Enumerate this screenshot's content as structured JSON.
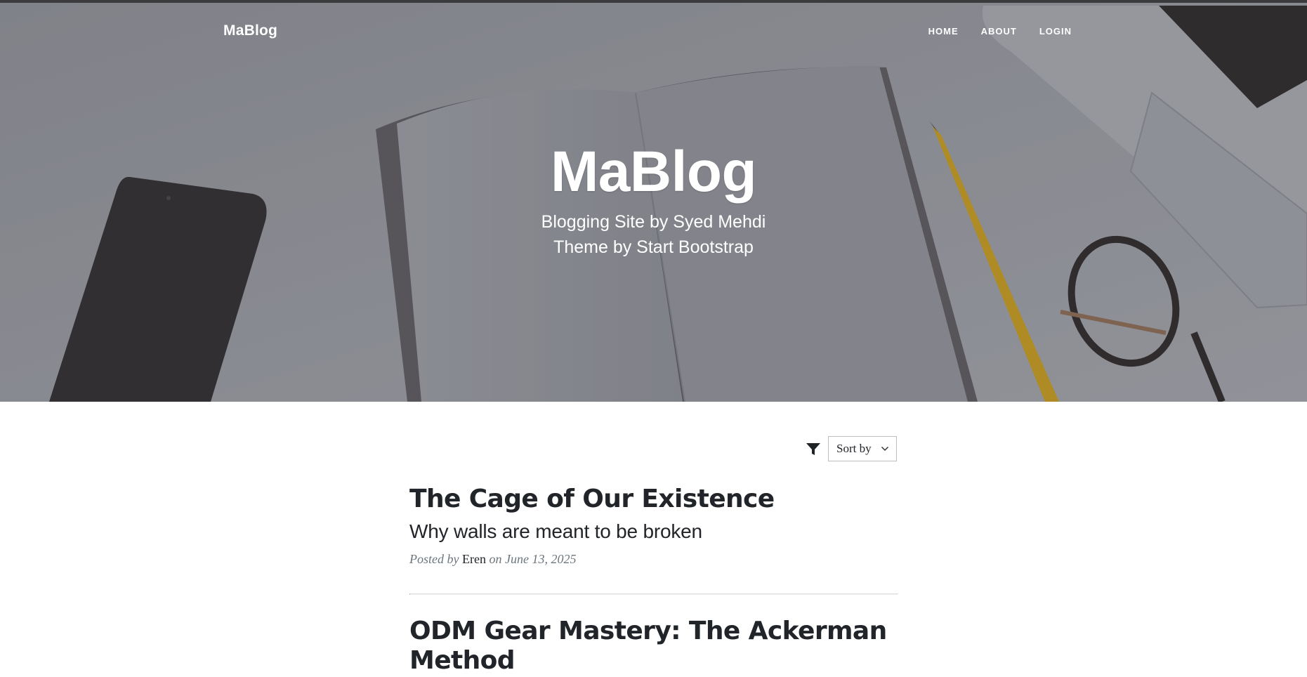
{
  "navbar": {
    "brand": "MaBlog",
    "links": [
      {
        "label": "HOME"
      },
      {
        "label": "ABOUT"
      },
      {
        "label": "LOGIN"
      }
    ]
  },
  "header": {
    "title": "MaBlog",
    "subtitle_line1": "Blogging Site by Syed Mehdi",
    "subtitle_line2": "Theme by Start Bootstrap"
  },
  "toolbar": {
    "filter_icon": "filter-icon",
    "sort_label": "Sort by"
  },
  "posts": [
    {
      "title": "The Cage of Our Existence",
      "subtitle": "Why walls are meant to be broken",
      "meta_prefix": "Posted by",
      "author": "Eren",
      "meta_suffix": "on June 13, 2025"
    },
    {
      "title": "ODM Gear Mastery: The Ackerman Method"
    }
  ]
}
